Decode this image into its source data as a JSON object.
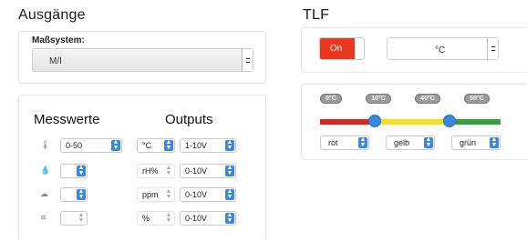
{
  "left": {
    "title": "Ausgänge",
    "measure": {
      "label": "Maßsystem:",
      "value": "M/I"
    },
    "table": {
      "header_left": "Messwerte",
      "header_right": "Outputs",
      "rows": [
        {
          "icon": "thermometer-icon",
          "glyph": "🌡",
          "range": "0-50",
          "unit": "°C",
          "output": "1-10V",
          "range_enabled": true
        },
        {
          "icon": "humidity-icon",
          "glyph": "💧",
          "range": "",
          "unit": "rH%",
          "output": "0-10V",
          "range_enabled": true
        },
        {
          "icon": "co2-icon",
          "glyph": "☁",
          "range": "",
          "unit": "ppm",
          "output": "0-10V",
          "range_enabled": true
        },
        {
          "icon": "voc-icon",
          "glyph": "≋",
          "range": "",
          "unit": "%",
          "output": "0-10V",
          "range_enabled": false
        }
      ]
    }
  },
  "right": {
    "title": "TLF",
    "toggle": {
      "label": "On",
      "state": "on",
      "color": "#e8391e"
    },
    "unit_select": "°C",
    "scale": {
      "labels": [
        "0°C",
        "10°C",
        "40°C",
        "50°C"
      ],
      "colors": {
        "red": "#e02020",
        "yellow": "#f2e21a",
        "green": "#2fa33a"
      },
      "knob_positions_celsius": [
        10,
        40
      ]
    },
    "color_selects": [
      "rot",
      "gelb",
      "grün"
    ]
  }
}
